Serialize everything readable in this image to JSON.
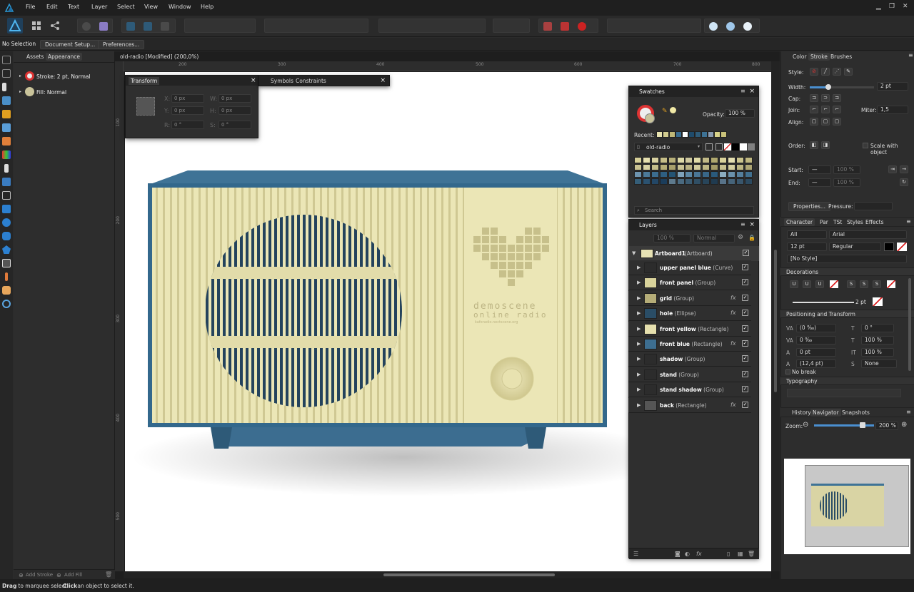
{
  "menu": [
    "File",
    "Edit",
    "Text",
    "Layer",
    "Select",
    "View",
    "Window",
    "Help"
  ],
  "context": {
    "selection": "No Selection",
    "doc_setup": "Document Setup...",
    "prefs": "Preferences..."
  },
  "left_panel": {
    "tabs": [
      "Assets",
      "Appearance"
    ],
    "stroke_label": "Stroke: 2 pt,  Normal",
    "fill_label": "Fill:  Normal",
    "add_stroke": "Add Stroke",
    "add_fill": "Add Fill"
  },
  "document": {
    "title": "old-radio [Modified] (200,0%)"
  },
  "ruler_h": [
    "200",
    "300",
    "400",
    "500",
    "600",
    "700",
    "800"
  ],
  "ruler_v": [
    "100",
    "200",
    "300",
    "400",
    "500"
  ],
  "transform": {
    "title": "Transform",
    "tabs": [
      "Symbols",
      "Constraints"
    ],
    "x_label": "X:",
    "y_label": "Y:",
    "w_label": "W:",
    "h_label": "H:",
    "r_label": "R:",
    "s_label": "S:",
    "x": "0 px",
    "y": "0 px",
    "w": "0 px",
    "h": "0 px",
    "r": "0 °",
    "s": "0 °"
  },
  "swatches": {
    "title": "Swatches",
    "opacity_label": "Opacity:",
    "opacity": "100 %",
    "recent_label": "Recent:",
    "palette": "old-radio",
    "search": "Search",
    "recent": [
      "#e8e3b0",
      "#d2cc8f",
      "#c0b878",
      "#3a6e92",
      "#ffffff",
      "#1f4b6b",
      "#2e5b78",
      "#3d7295",
      "#8a9bb0",
      "#d9d38a",
      "#c9c27a"
    ],
    "grid": [
      "#d6cf98",
      "#e6e0b0",
      "#d8d1a1",
      "#c6be88",
      "#b8b07a",
      "#dedaa8",
      "#cfc99e",
      "#e0dba8",
      "#c1b987",
      "#b0a86f",
      "#d9d29b",
      "#e5dfb1",
      "#cbc48e",
      "#bfb780",
      "#c9c291",
      "#d8d2a5",
      "#c4bd8a",
      "#b5ad76",
      "#a8a06c",
      "#c8c294",
      "#b9b283",
      "#d1cb9d",
      "#bdb684",
      "#a49b67",
      "#c7c08f",
      "#d4ce9f",
      "#bcb582",
      "#aea674",
      "#6d93ae",
      "#4c7a99",
      "#3c6d8f",
      "#2e5f82",
      "#245474",
      "#7ea2ba",
      "#5c87a4",
      "#4a7696",
      "#396788",
      "#2a5a7c",
      "#8bacbf",
      "#6a91ab",
      "#557f9c",
      "#41708f",
      "#355e78",
      "#2b5270",
      "#234766",
      "#1b3d5b",
      "#5e7a8d",
      "#4a6a80",
      "#3c5c72",
      "#304f65",
      "#28455a",
      "#203b50",
      "#587389",
      "#46647a",
      "#39566c",
      "#2c4a60"
    ]
  },
  "layers": {
    "title": "Layers",
    "opacity": "100 %",
    "blend": "Normal",
    "artboard": "Artboard1",
    "artboard_type": "(Artboard)",
    "items": [
      {
        "name": "upper panel blue",
        "type": "(Curve)",
        "fx": false,
        "thumb": "#2c2c2c"
      },
      {
        "name": "front panel",
        "type": "(Group)",
        "fx": false,
        "thumb": "#d9d39b"
      },
      {
        "name": "grid",
        "type": "(Group)",
        "fx": true,
        "thumb": "#b5ad78"
      },
      {
        "name": "hole",
        "type": "(Ellipse)",
        "fx": true,
        "thumb": "#2a4d66"
      },
      {
        "name": "front yellow",
        "type": "(Rectangle)",
        "fx": false,
        "thumb": "#e6e0ae"
      },
      {
        "name": "front blue",
        "type": "(Rectangle)",
        "fx": true,
        "thumb": "#3d6e90"
      },
      {
        "name": "shadow",
        "type": "(Group)",
        "fx": false,
        "thumb": "#2c2c2c"
      },
      {
        "name": "stand",
        "type": "(Group)",
        "fx": false,
        "thumb": "#2c2c2c"
      },
      {
        "name": "stand shadow",
        "type": "(Group)",
        "fx": false,
        "thumb": "#2c2c2c"
      },
      {
        "name": "back",
        "type": "(Rectangle)",
        "fx": true,
        "thumb": "#555"
      }
    ]
  },
  "stroke_panel": {
    "tabs": [
      "Color",
      "Stroke",
      "Brushes"
    ],
    "style_label": "Style:",
    "width_label": "Width:",
    "width": "2 pt",
    "cap_label": "Cap:",
    "join_label": "Join:",
    "miter_label": "Miter:",
    "miter": "1,5",
    "align_label": "Align:",
    "order_label": "Order:",
    "scale_label": "Scale with object",
    "start_label": "Start:",
    "end_label": "End:",
    "start_pct": "100 %",
    "end_pct": "100 %",
    "properties": "Properties...",
    "pressure_label": "Pressure:"
  },
  "character": {
    "tabs": [
      "Character",
      "Par",
      "TSt",
      "Styles",
      "Effects"
    ],
    "scope": "All",
    "font": "Arial",
    "size": "12 pt",
    "weight": "Regular",
    "style": "[No Style]",
    "decorations": "Decorations",
    "deco_width": "2 pt",
    "pos_transform": "Positioning and Transform",
    "kern": "(0 ‰)",
    "track": "0 ‰",
    "baseline": "0 pt",
    "leading": "(12,4 pt)",
    "shear": "0 °",
    "hscale": "100 %",
    "vscale": "100 %",
    "script": "None",
    "no_break": "No break",
    "typography": "Typography"
  },
  "navigator": {
    "tabs": [
      "History",
      "Navigator",
      "Snapshots"
    ],
    "zoom_label": "Zoom:",
    "zoom": "200 %"
  },
  "radio": {
    "brand_line1": "demoscene",
    "brand_line2": "online radio",
    "brand_line3": "kaferadio.nectscene.org"
  },
  "status": {
    "drag": "Drag",
    "text1": " to marquee select. ",
    "click": "Click",
    "text2": " an object to select it."
  }
}
